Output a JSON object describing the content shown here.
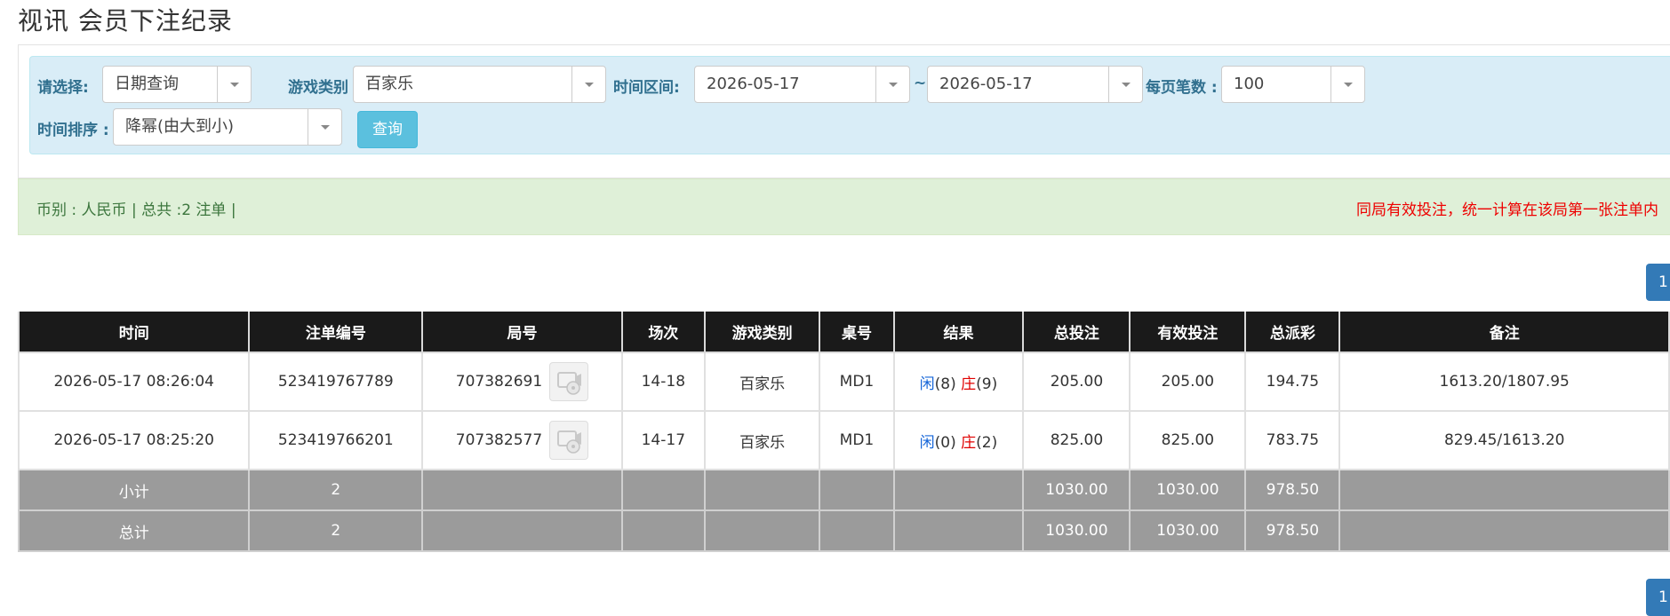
{
  "page_title": "视讯 会员下注纪录",
  "filters": {
    "select_label": "请选择:",
    "select_value": "日期查询",
    "game_type_label": "游戏类别",
    "game_type_value": "百家乐",
    "time_range_label": "时间区间:",
    "date_from": "2026-05-17",
    "tilde": "~",
    "date_to": "2026-05-17",
    "per_page_label": "每页笔数 :",
    "per_page_value": "100",
    "sort_label": "时间排序 :",
    "sort_value": "降幂(由大到小)",
    "query_button": "查询"
  },
  "summary": {
    "left": "币别 : 人民币 | 总共 :2 注单 |",
    "right": "同局有效投注，统一计算在该局第一张注单内"
  },
  "pagination": {
    "current": "1"
  },
  "table": {
    "headers": [
      "时间",
      "注单编号",
      "局号",
      "场次",
      "游戏类别",
      "桌号",
      "结果",
      "总投注",
      "有效投注",
      "总派彩",
      "备注"
    ],
    "rows": [
      {
        "time": "2026-05-17 08:26:04",
        "bet_id": "523419767789",
        "round_no": "707382691",
        "session": "14-18",
        "game": "百家乐",
        "table": "MD1",
        "result_player_label": "闲",
        "result_player_value": "(8)",
        "result_banker_label": "庄",
        "result_banker_value": "(9)",
        "total_bet": "205.00",
        "valid_bet": "205.00",
        "payout": "194.75",
        "note": "1613.20/1807.95"
      },
      {
        "time": "2026-05-17 08:25:20",
        "bet_id": "523419766201",
        "round_no": "707382577",
        "session": "14-17",
        "game": "百家乐",
        "table": "MD1",
        "result_player_label": "闲",
        "result_player_value": "(0)",
        "result_banker_label": "庄",
        "result_banker_value": "(2)",
        "total_bet": "825.00",
        "valid_bet": "825.00",
        "payout": "783.75",
        "note": "829.45/1613.20"
      }
    ],
    "subtotal": {
      "label": "小计",
      "count": "2",
      "total_bet": "1030.00",
      "valid_bet": "1030.00",
      "payout": "978.50"
    },
    "grandtotal": {
      "label": "总计",
      "count": "2",
      "total_bet": "1030.00",
      "valid_bet": "1030.00",
      "payout": "978.50"
    }
  },
  "colors": {
    "header_bg": "#1a1a1a",
    "footer_bg": "#9b9b9b",
    "player": "#1565d8",
    "banker": "#e00000",
    "link": "#1565d8"
  },
  "icons": {
    "video": "video-replay-icon",
    "dropdown": "chevron-down-icon"
  }
}
